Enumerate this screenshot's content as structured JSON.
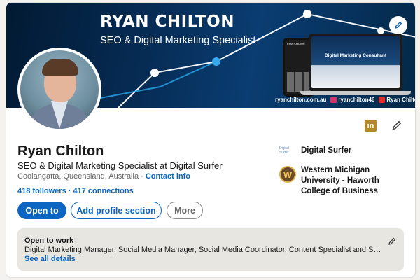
{
  "banner": {
    "name": "RYAN CHILTON",
    "subtitle": "SEO & Digital Marketing Specialist",
    "laptop_title": "Digital Marketing Consultant",
    "phone_title": "RYAN CHILTON",
    "website": "ryanchilton.com.au",
    "instagram_handle": "ryanchilton46",
    "youtube_name": "Ryan Chilton"
  },
  "profile": {
    "name": "Ryan Chilton",
    "headline": "SEO & Digital Marketing Specialist at Digital Surfer",
    "location": "Coolangatta, Queensland, Australia",
    "separator": "·",
    "contact_info": "Contact info",
    "followers": "418 followers",
    "network_separator": "·",
    "connections": "417 connections"
  },
  "actions": {
    "open_to": "Open to",
    "add_section": "Add profile section",
    "more": "More"
  },
  "experience": {
    "company_logo_text": "Digital Surfer",
    "company": "Digital Surfer",
    "school_logo_letter": "W",
    "school": "Western Michigan University - Haworth College of Business"
  },
  "open_to_work": {
    "title": "Open to work",
    "roles": "Digital Marketing Manager, Social Media Manager, Social Media Coordinator, Content Specialist and Search Engine Optimization Specialist roles",
    "link": "See all details"
  },
  "icons": {
    "linkedin_badge": "in",
    "banner_edit": "pencil-icon",
    "profile_edit": "pencil-icon",
    "otw_edit": "pencil-icon"
  },
  "colors": {
    "primary": "#0a66c2",
    "linkedin_badge": "#b3882b"
  }
}
